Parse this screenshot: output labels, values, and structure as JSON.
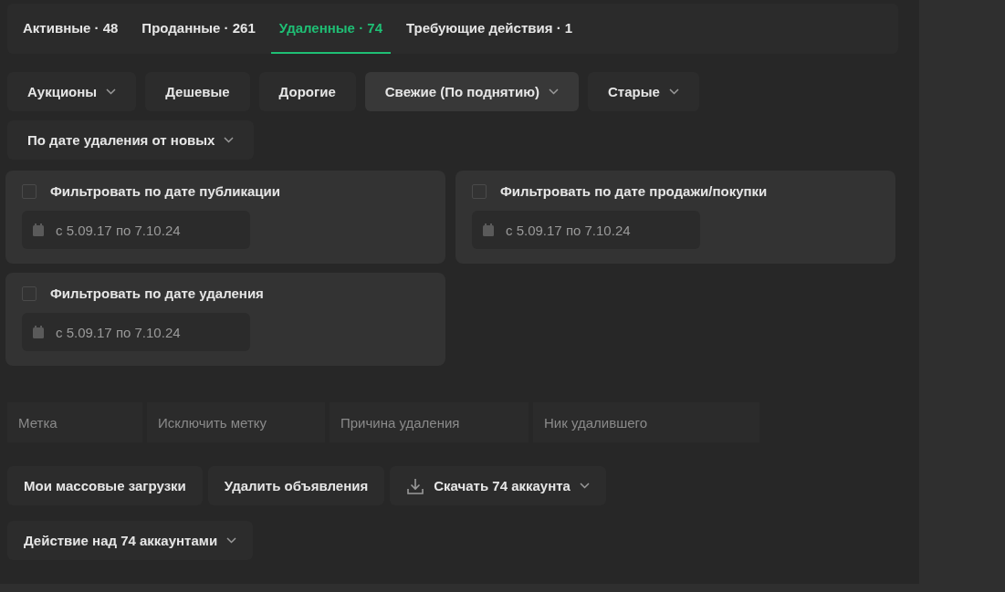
{
  "tabs": [
    {
      "label": "Активные · 48",
      "selected": false
    },
    {
      "label": "Проданные · 261",
      "selected": false
    },
    {
      "label": "Удаленные · 74",
      "selected": true
    },
    {
      "label": "Требующие действия · 1",
      "selected": false
    }
  ],
  "sort_buttons": [
    {
      "label": "Аукционы",
      "dropdown": true,
      "selected": false
    },
    {
      "label": "Дешевые",
      "dropdown": false,
      "selected": false
    },
    {
      "label": "Дорогие",
      "dropdown": false,
      "selected": false
    },
    {
      "label": "Свежие (По поднятию)",
      "dropdown": true,
      "selected": true
    },
    {
      "label": "Старые",
      "dropdown": true,
      "selected": false
    },
    {
      "label": "По дате удаления от новых",
      "dropdown": true,
      "selected": false
    }
  ],
  "date_filters": [
    {
      "label": "Фильтровать по дате публикации",
      "checked": false,
      "range": "с 5.09.17 по 7.10.24"
    },
    {
      "label": "Фильтровать по дате продажи/покупки",
      "checked": false,
      "range": "с 5.09.17 по 7.10.24"
    },
    {
      "label": "Фильтровать по дате удаления",
      "checked": false,
      "range": "с 5.09.17 по 7.10.24"
    }
  ],
  "fields": [
    {
      "placeholder": "Метка"
    },
    {
      "placeholder": "Исключить метку"
    },
    {
      "placeholder": "Причина удаления"
    },
    {
      "placeholder": "Ник удалившего"
    }
  ],
  "actions": [
    {
      "label": "Мои массовые загрузки",
      "kind": "plain",
      "dropdown": false
    },
    {
      "label": "Удалить объявления",
      "kind": "plain",
      "dropdown": false
    },
    {
      "label": "Скачать 74 аккаунта",
      "kind": "download",
      "dropdown": true
    },
    {
      "label": "Действие над 74 аккаунтами",
      "kind": "plain",
      "dropdown": true
    }
  ]
}
